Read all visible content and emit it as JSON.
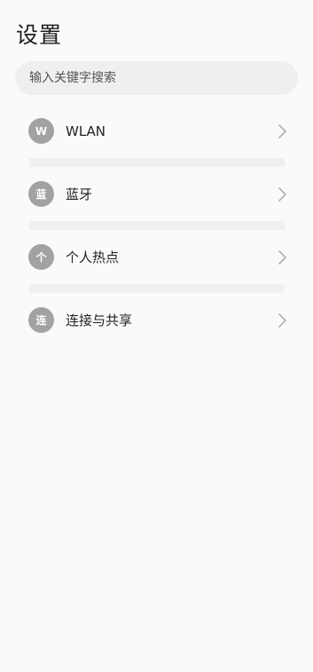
{
  "header": {
    "title": "设置"
  },
  "search": {
    "placeholder": "输入关键字搜索"
  },
  "settings": {
    "items": [
      {
        "avatar_text": "W",
        "label": "WLAN",
        "icon": "chevron-right-icon"
      },
      {
        "avatar_text": "蓝",
        "label": "蓝牙",
        "icon": "chevron-right-icon"
      },
      {
        "avatar_text": "个",
        "label": "个人热点",
        "icon": "chevron-right-icon"
      },
      {
        "avatar_text": "连",
        "label": "连接与共享",
        "icon": "chevron-right-icon"
      }
    ]
  },
  "colors": {
    "background": "#fafafa",
    "search_bg": "#efefef",
    "avatar_bg": "#a2a2a2",
    "divider": "#f0f0f0",
    "chevron": "#b0b0b0"
  }
}
